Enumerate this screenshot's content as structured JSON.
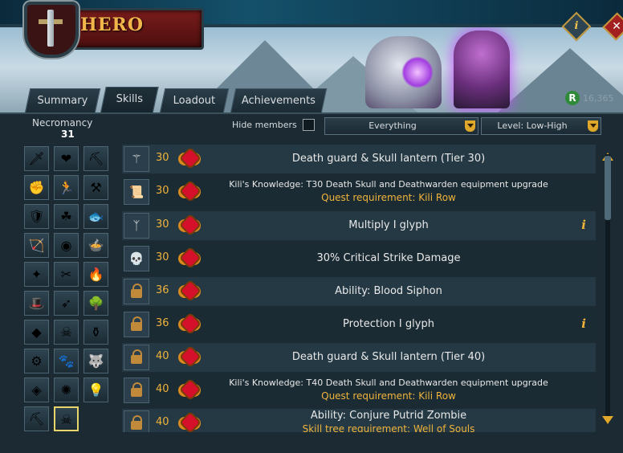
{
  "window": {
    "title": "HERO",
    "runecoins": "16,365"
  },
  "tabs": [
    {
      "label": "Summary"
    },
    {
      "label": "Skills"
    },
    {
      "label": "Loadout"
    },
    {
      "label": "Achievements"
    }
  ],
  "skill": {
    "name": "Necromancy",
    "level": "31"
  },
  "filters": {
    "hide_members_label": "Hide members",
    "hide_members_checked": false,
    "type_select": "Everything",
    "sort_select": "Level: Low-High"
  },
  "unlocks": [
    {
      "level": "30",
      "text": "Death guard & Skull lantern (Tier 30)",
      "locked": false,
      "icon": "staff-icon"
    },
    {
      "level": "30",
      "text": "Kili's Knowledge: T30 Death Skull and Deathwarden equipment upgrade",
      "req": "Quest requirement: Kili Row",
      "locked": false,
      "icon": "scroll-icon"
    },
    {
      "level": "30",
      "text": "Multiply I glyph",
      "locked": false,
      "icon": "glyph-icon",
      "info": "i"
    },
    {
      "level": "30",
      "text": "30% Critical Strike Damage",
      "locked": false,
      "icon": "skull-icon"
    },
    {
      "level": "36",
      "text": "Ability: Blood Siphon",
      "locked": true
    },
    {
      "level": "36",
      "text": "Protection I glyph",
      "locked": true,
      "info": "i"
    },
    {
      "level": "40",
      "text": "Death guard & Skull lantern (Tier 40)",
      "locked": true
    },
    {
      "level": "40",
      "text": "Kili's Knowledge: T40 Death Skull and Deathwarden equipment upgrade",
      "req": "Quest requirement: Kili Row",
      "locked": true
    },
    {
      "level": "40",
      "text": "Ability: Conjure Putrid Zombie",
      "req": "Skill tree requirement: Well of Souls",
      "locked": true
    }
  ],
  "skills_grid": [
    "attack-icon",
    "constitution-icon",
    "mining-icon",
    "strength-icon",
    "agility-icon",
    "smithing-icon",
    "defence-icon",
    "herblore-icon",
    "fishing-icon",
    "ranged-icon",
    "thieving-icon",
    "cooking-icon",
    "prayer-icon",
    "crafting-icon",
    "firemaking-icon",
    "magic-icon",
    "fletching-icon",
    "woodcutting-icon",
    "runecrafting-icon",
    "slayer-icon",
    "farming-icon",
    "construction-icon",
    "hunter-icon",
    "summoning-icon",
    "dungeoneering-icon",
    "divination-icon",
    "invention-icon",
    "archaeology-icon",
    "necromancy-icon"
  ]
}
